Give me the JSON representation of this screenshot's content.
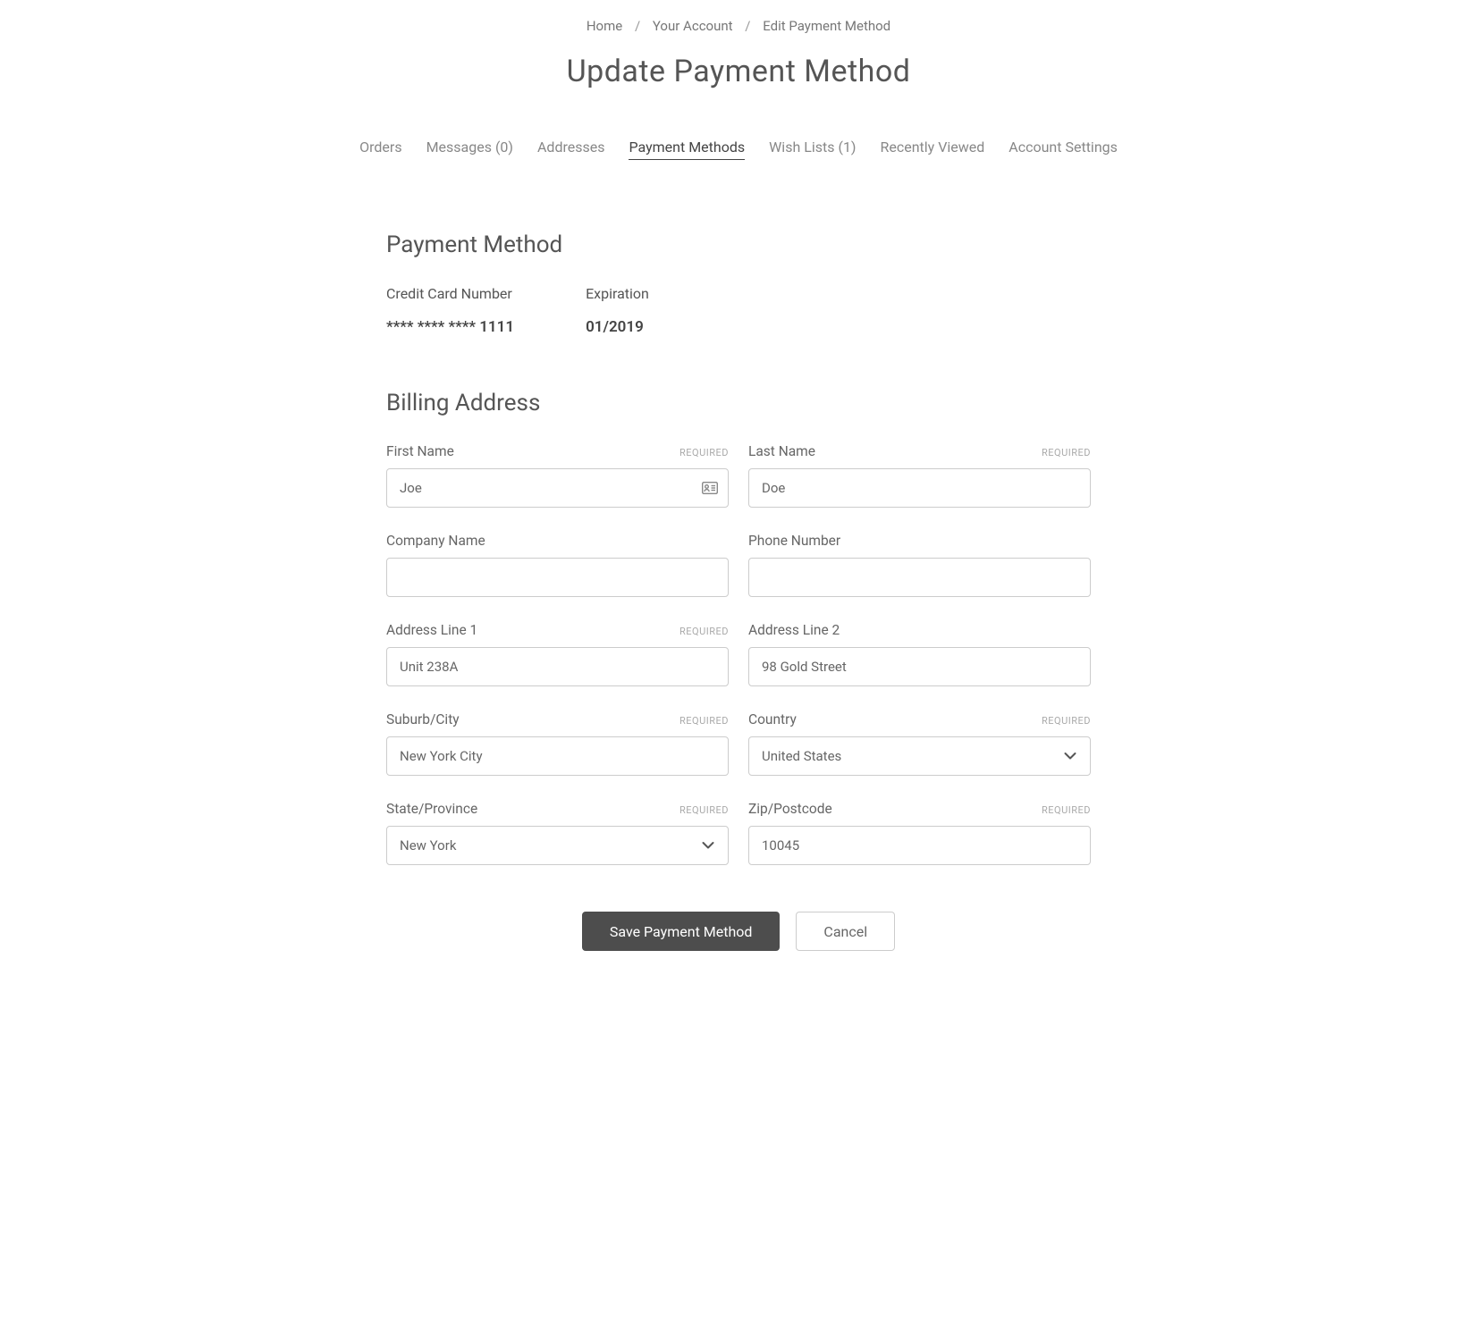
{
  "breadcrumb": {
    "home": "Home",
    "account": "Your Account",
    "edit": "Edit Payment Method"
  },
  "pageTitle": "Update Payment Method",
  "tabs": {
    "orders": "Orders",
    "messages": "Messages (0)",
    "addresses": "Addresses",
    "payment": "Payment Methods",
    "wishlists": "Wish Lists (1)",
    "recently": "Recently Viewed",
    "settings": "Account Settings"
  },
  "sections": {
    "paymentMethod": "Payment Method",
    "billingAddress": "Billing Address"
  },
  "payment": {
    "ccLabel": "Credit Card Number",
    "ccValue": "**** **** **** 1111",
    "expLabel": "Expiration",
    "expValue": "01/2019"
  },
  "labels": {
    "firstName": "First Name",
    "lastName": "Last Name",
    "company": "Company Name",
    "phone": "Phone Number",
    "address1": "Address Line 1",
    "address2": "Address Line 2",
    "city": "Suburb/City",
    "country": "Country",
    "state": "State/Province",
    "zip": "Zip/Postcode",
    "required": "REQUIRED"
  },
  "values": {
    "firstName": "Joe",
    "lastName": "Doe",
    "company": "",
    "phone": "",
    "address1": "Unit 238A",
    "address2": "98 Gold Street",
    "city": "New York City",
    "country": "United States",
    "state": "New York",
    "zip": "10045"
  },
  "buttons": {
    "save": "Save Payment Method",
    "cancel": "Cancel"
  }
}
